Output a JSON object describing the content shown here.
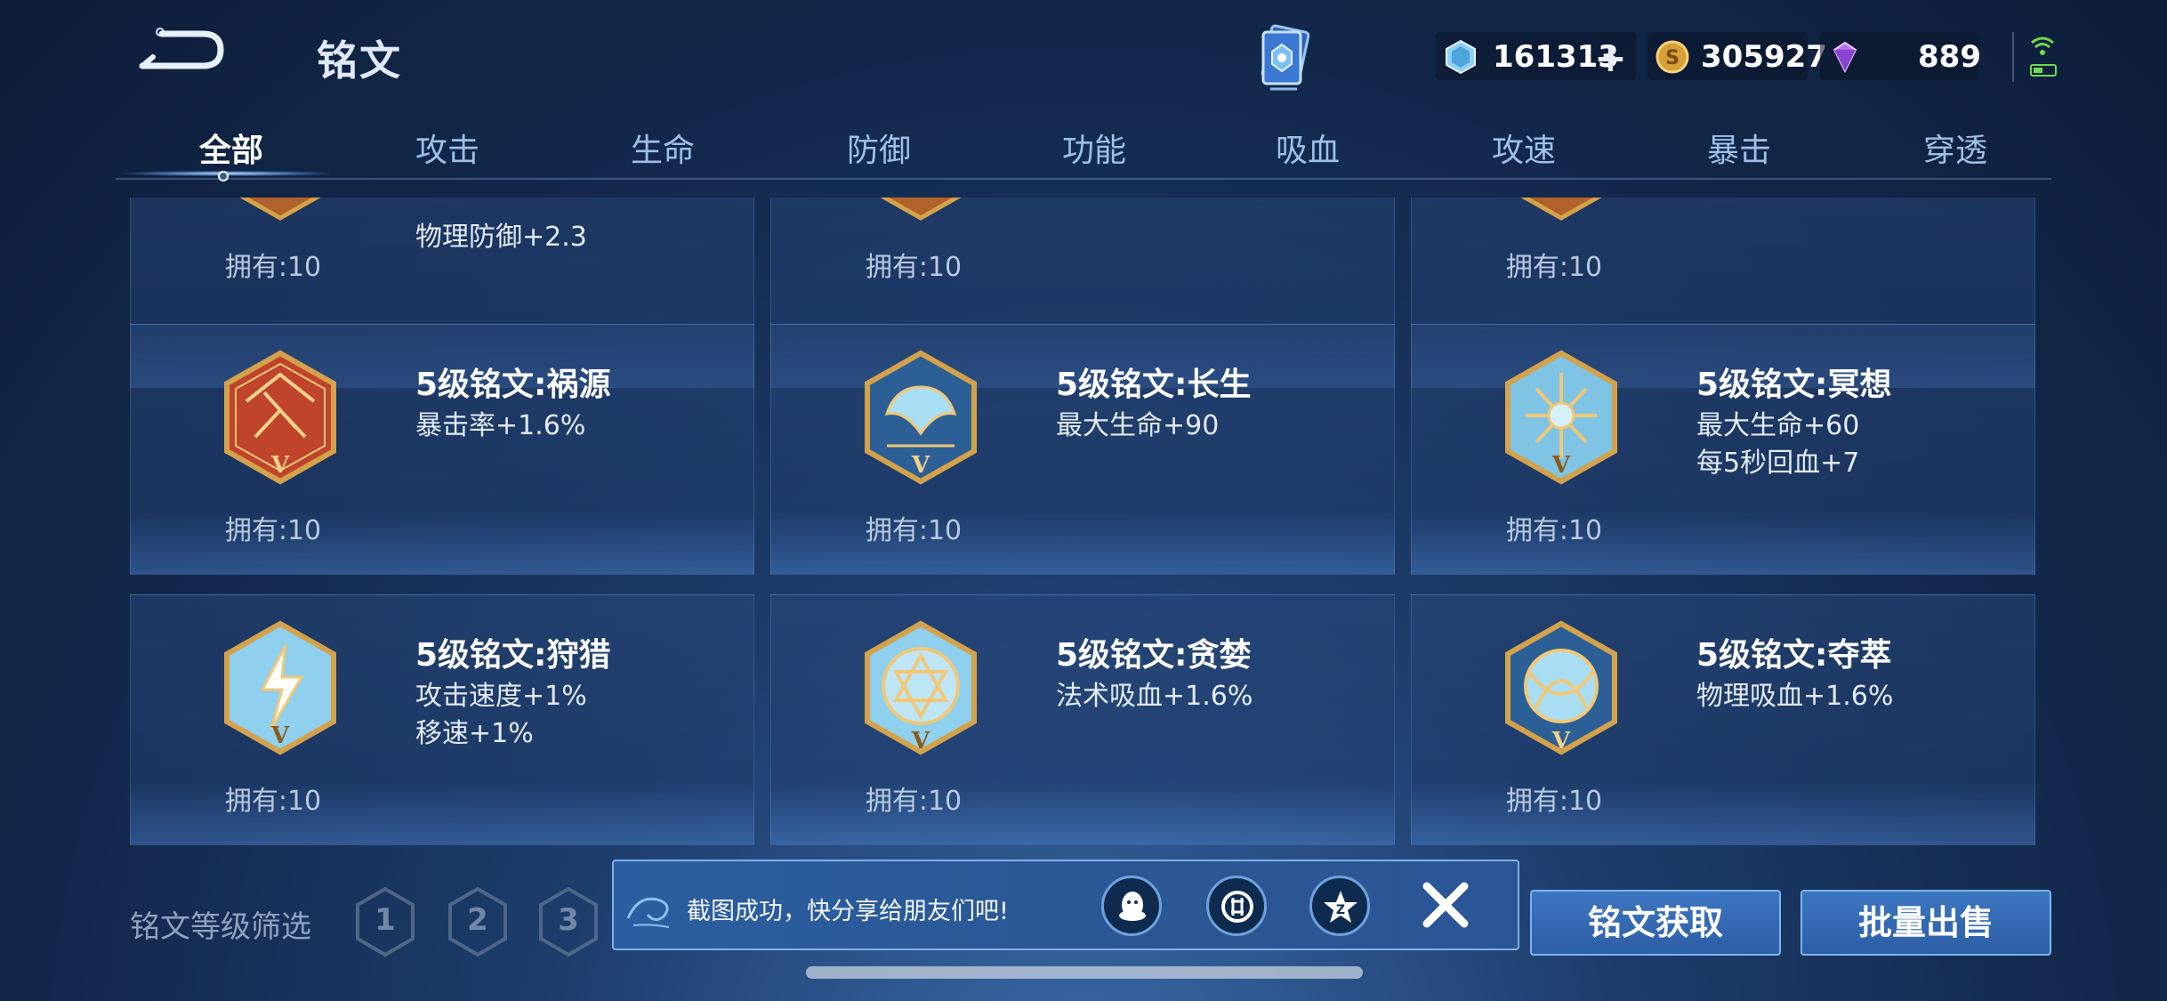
{
  "header": {
    "title": "铭文",
    "currency": {
      "crystal": "161313",
      "gold": "305927",
      "gem": "889"
    }
  },
  "tabs": [
    "全部",
    "攻击",
    "生命",
    "防御",
    "功能",
    "吸血",
    "攻速",
    "暴击",
    "穿透"
  ],
  "active_tab": "全部",
  "runes_partial": [
    {
      "attrs": [
        "物理防御+2.3"
      ],
      "owned": "拥有:10"
    },
    {
      "attrs": [],
      "owned": "拥有:10"
    },
    {
      "attrs": [],
      "owned": "拥有:10"
    }
  ],
  "runes": [
    {
      "name": "5级铭文:祸源",
      "attrs": [
        "暴击率+1.6%"
      ],
      "owned": "拥有:10",
      "color": "red"
    },
    {
      "name": "5级铭文:长生",
      "attrs": [
        "最大生命+90"
      ],
      "owned": "拥有:10",
      "color": "blue"
    },
    {
      "name": "5级铭文:冥想",
      "attrs": [
        "最大生命+60",
        "每5秒回血+7"
      ],
      "owned": "拥有:10",
      "color": "blue"
    },
    {
      "name": "5级铭文:狩猎",
      "attrs": [
        "攻击速度+1%",
        "移速+1%"
      ],
      "owned": "拥有:10",
      "color": "blue"
    },
    {
      "name": "5级铭文:贪婪",
      "attrs": [
        "法术吸血+1.6%"
      ],
      "owned": "拥有:10",
      "color": "blue"
    },
    {
      "name": "5级铭文:夺萃",
      "attrs": [
        "物理吸血+1.6%"
      ],
      "owned": "拥有:10",
      "color": "blue"
    }
  ],
  "filter": {
    "label": "铭文等级筛选",
    "levels": [
      "1",
      "2",
      "3"
    ]
  },
  "toast": {
    "message": "截图成功，快分享给朋友们吧!",
    "share_targets": [
      "qq-icon",
      "wechat-moments-icon",
      "qzone-icon"
    ]
  },
  "buttons": {
    "obtain": "铭文获取",
    "bulk_sell": "批量出售"
  },
  "colors": {
    "accent": "#2d5ea6",
    "rune_gold": "#d4a24a",
    "rune_red": "#c0432b",
    "rune_blue": "#9fd3ee"
  }
}
